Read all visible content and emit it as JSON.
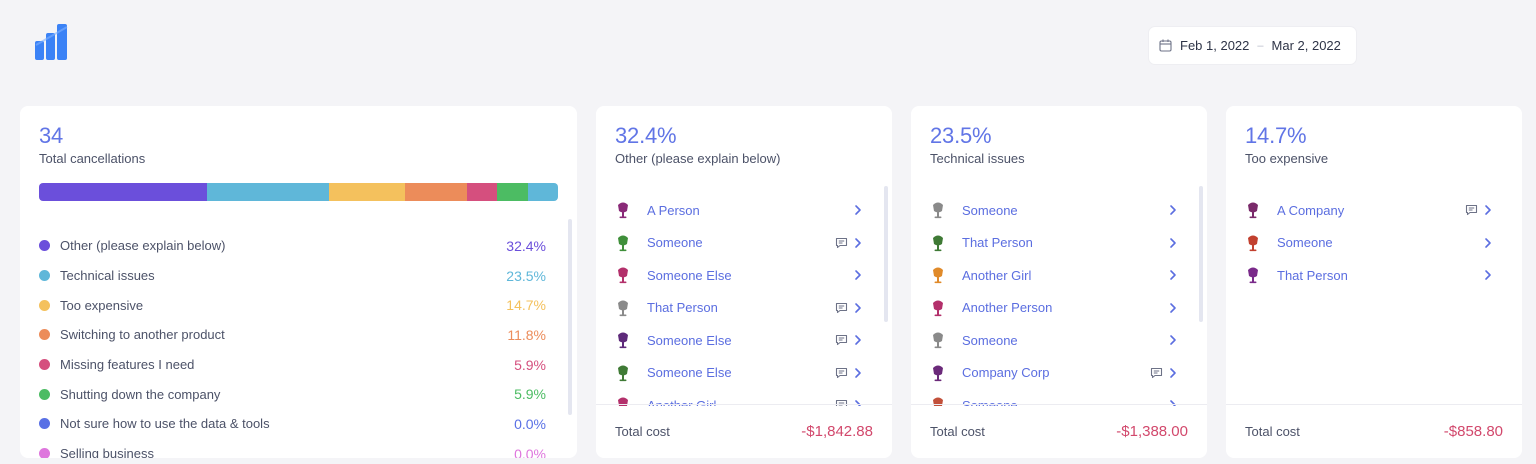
{
  "header": {
    "logo_icon": "bar-chart-logo-icon",
    "date_from": "Feb 1, 2022",
    "date_to": "Mar 2, 2022",
    "date_separator": "–"
  },
  "summary": {
    "total": "34",
    "total_label": "Total cancellations",
    "reasons": [
      {
        "name": "Other (please explain below)",
        "pct": "32.4%",
        "share": 32.4,
        "color": "#6b4fdb"
      },
      {
        "name": "Technical issues",
        "pct": "23.5%",
        "share": 23.5,
        "color": "#5fb7d9"
      },
      {
        "name": "Too expensive",
        "pct": "14.7%",
        "share": 14.7,
        "color": "#f4c15d"
      },
      {
        "name": "Switching to another product",
        "pct": "11.8%",
        "share": 11.8,
        "color": "#ec8c5a"
      },
      {
        "name": "Missing features I need",
        "pct": "5.9%",
        "share": 5.9,
        "color": "#d54f7e"
      },
      {
        "name": "Shutting down the company",
        "pct": "5.9%",
        "share": 5.9,
        "color": "#4cbc63"
      },
      {
        "name": "Not sure how to use the data & tools",
        "pct": "0.0%",
        "share": 0,
        "color": "#5970e5"
      },
      {
        "name": "Selling business",
        "pct": "0.0%",
        "share": 0,
        "color": "#de76dd"
      }
    ],
    "bar_tail_color": "#5fb7d9"
  },
  "cards": [
    {
      "pct": "32.4%",
      "reason": "Other (please explain below)",
      "total_label": "Total cost",
      "total_value": "-$1,842.88",
      "people": [
        {
          "name": "A Person",
          "color": "#8a2a78",
          "comment": false
        },
        {
          "name": "Someone",
          "color": "#3f8f3a",
          "comment": true
        },
        {
          "name": "Someone Else",
          "color": "#b3306b",
          "comment": false
        },
        {
          "name": "That Person",
          "color": "#8a8a8a",
          "comment": true
        },
        {
          "name": "Someone Else",
          "color": "#5e2a7a",
          "comment": true
        },
        {
          "name": "Someone Else",
          "color": "#3f7a35",
          "comment": true
        },
        {
          "name": "Another Girl",
          "color": "#b3306b",
          "comment": true
        }
      ]
    },
    {
      "pct": "23.5%",
      "reason": "Technical issues",
      "total_label": "Total cost",
      "total_value": "-$1,388.00",
      "people": [
        {
          "name": "Someone",
          "color": "#8a8a8a",
          "comment": false
        },
        {
          "name": "That Person",
          "color": "#3f7a35",
          "comment": false
        },
        {
          "name": "Another Girl",
          "color": "#e08a2a",
          "comment": false
        },
        {
          "name": "Another Person",
          "color": "#b3306b",
          "comment": false
        },
        {
          "name": "Someone",
          "color": "#8a8a8a",
          "comment": false
        },
        {
          "name": "Company Corp",
          "color": "#6b2a7a",
          "comment": true
        },
        {
          "name": "Someone",
          "color": "#c2503a",
          "comment": false
        }
      ]
    },
    {
      "pct": "14.7%",
      "reason": "Too expensive",
      "total_label": "Total cost",
      "total_value": "-$858.80",
      "people": [
        {
          "name": "A Company",
          "color": "#7a2a6a",
          "comment": true
        },
        {
          "name": "Someone",
          "color": "#c2402f",
          "comment": false
        },
        {
          "name": "That Person",
          "color": "#7a2a8a",
          "comment": false
        }
      ]
    }
  ]
}
